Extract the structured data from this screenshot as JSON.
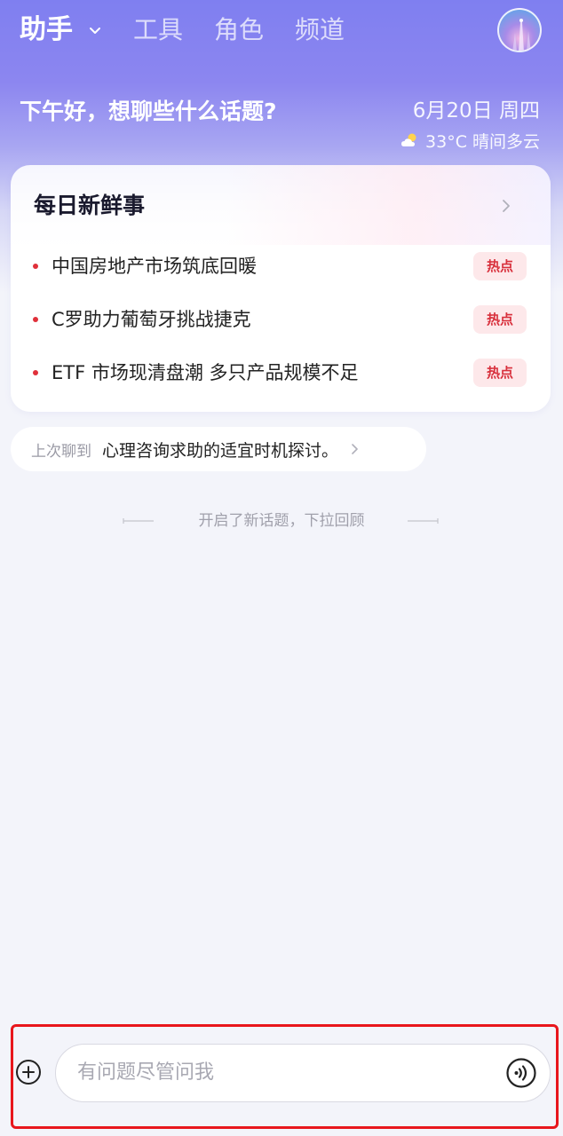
{
  "nav": {
    "tabs": [
      {
        "label": "助手",
        "active": true
      },
      {
        "label": "工具",
        "active": false
      },
      {
        "label": "角色",
        "active": false
      },
      {
        "label": "频道",
        "active": false
      }
    ]
  },
  "header": {
    "greeting": "下午好，想聊些什么话题?",
    "date": "6月20日 周四",
    "weather": "33°C 晴间多云",
    "weather_icon": "partly-cloudy-icon"
  },
  "news": {
    "title": "每日新鲜事",
    "items": [
      {
        "text": "中国房地产市场筑底回暖",
        "badge": "热点"
      },
      {
        "text": "C罗助力葡萄牙挑战捷克",
        "badge": "热点"
      },
      {
        "text": "ETF 市场现清盘潮 多只产品规模不足",
        "badge": "热点"
      }
    ]
  },
  "last_chat": {
    "label": "上次聊到",
    "text": "心理咨询求助的适宜时机探讨。"
  },
  "divider": {
    "text": "开启了新话题，下拉回顾"
  },
  "input": {
    "placeholder": "有问题尽管问我"
  },
  "colors": {
    "accent": "#7f7ff0",
    "hot": "#d8303c",
    "highlight_border": "#e8161c"
  }
}
